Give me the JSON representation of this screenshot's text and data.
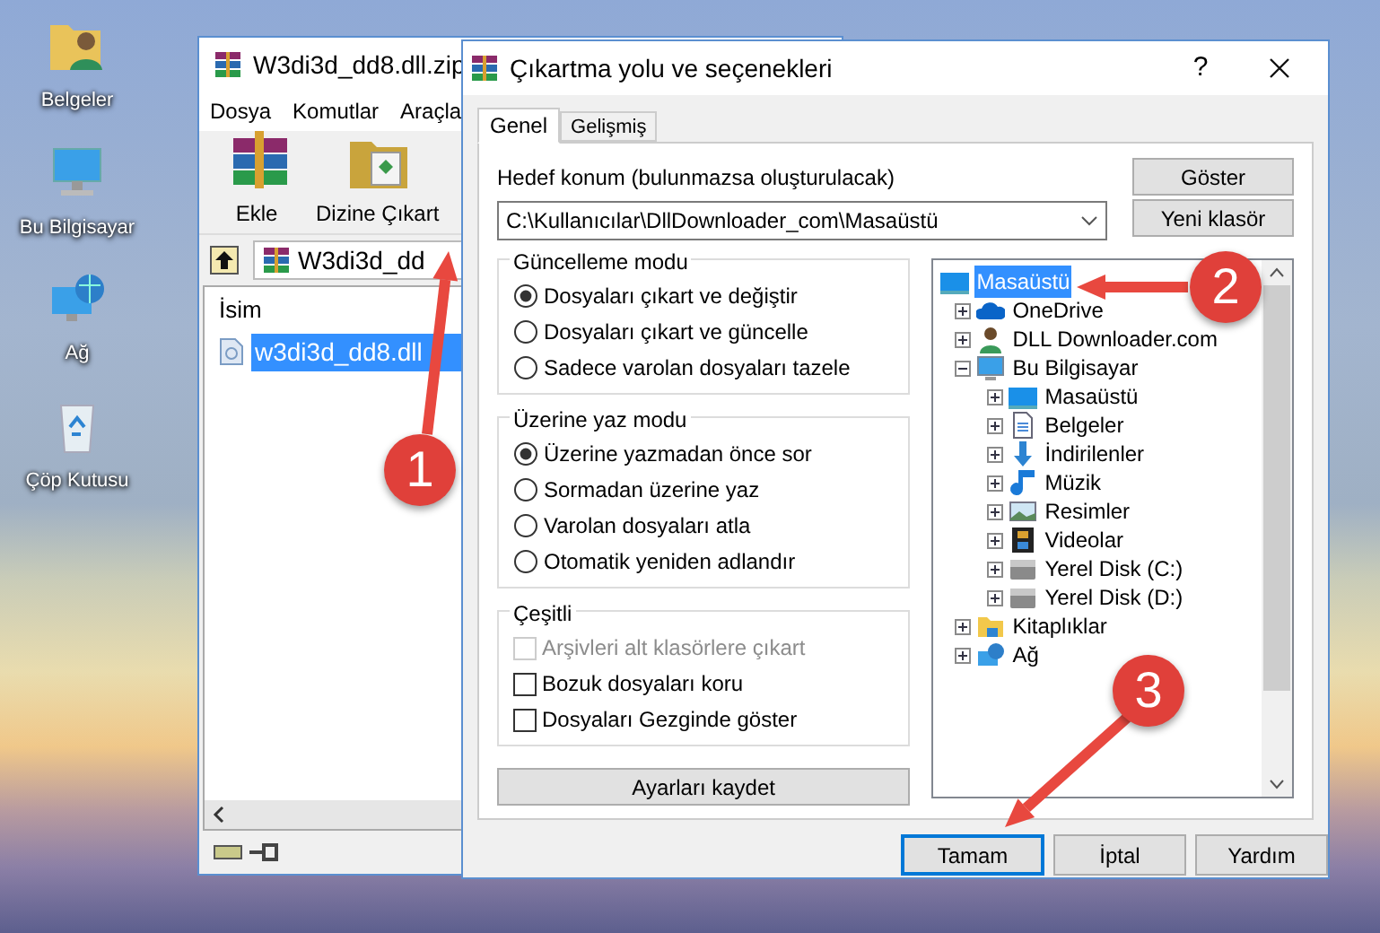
{
  "desktop_icons": [
    {
      "label": "Belgeler",
      "kind": "documents"
    },
    {
      "label": "Bu Bilgisayar",
      "kind": "computer"
    },
    {
      "label": "Ağ",
      "kind": "network"
    },
    {
      "label": "Çöp Kutusu",
      "kind": "recycle"
    }
  ],
  "archive_window": {
    "title": "W3di3d_dd8.dll.zip",
    "menu": [
      "Dosya",
      "Komutlar",
      "Araçla"
    ],
    "toolbar": [
      {
        "label": "Ekle",
        "kind": "add"
      },
      {
        "label": "Dizine Çıkart",
        "kind": "extract"
      }
    ],
    "address": "W3di3d_dd",
    "column": "İsim",
    "files": [
      {
        "name": "w3di3d_dd8.dll",
        "selected": true
      }
    ]
  },
  "dialog": {
    "title": "Çıkartma yolu ve seçenekleri",
    "help": "?",
    "tabs": [
      {
        "label": "Genel",
        "selected": true
      },
      {
        "label": "Gelişmiş",
        "selected": false
      }
    ],
    "destination_label": "Hedef konum (bulunmazsa oluşturulacak)",
    "destination_path": "C:\\Kullanıcılar\\DllDownloader_com\\Masaüstü",
    "side_buttons": [
      "Göster",
      "Yeni klasör"
    ],
    "groups": [
      {
        "title": "Güncelleme modu",
        "kind": "radio",
        "options": [
          {
            "label": "Dosyaları çıkart ve değiştir",
            "checked": true
          },
          {
            "label": "Dosyaları çıkart ve güncelle",
            "checked": false
          },
          {
            "label": "Sadece varolan dosyaları tazele",
            "checked": false
          }
        ]
      },
      {
        "title": "Üzerine yaz modu",
        "kind": "radio",
        "options": [
          {
            "label": "Üzerine yazmadan önce sor",
            "checked": true
          },
          {
            "label": "Sormadan üzerine yaz",
            "checked": false
          },
          {
            "label": "Varolan dosyaları atla",
            "checked": false
          },
          {
            "label": "Otomatik yeniden adlandır",
            "checked": false
          }
        ]
      },
      {
        "title": "Çeşitli",
        "kind": "checkbox",
        "options": [
          {
            "label": "Arşivleri alt klasörlere çıkart",
            "checked": false,
            "disabled": true
          },
          {
            "label": "Bozuk dosyaları koru",
            "checked": false,
            "disabled": false
          },
          {
            "label": "Dosyaları Gezginde göster",
            "checked": false,
            "disabled": false
          }
        ]
      }
    ],
    "save_button": "Ayarları kaydet",
    "tree": [
      {
        "label": "Masaüstü",
        "kind": "desktop",
        "selected": true,
        "children": [
          {
            "label": "OneDrive",
            "kind": "cloud",
            "selected": false,
            "expanded": false
          },
          {
            "label": "DLL Downloader.com",
            "kind": "user",
            "selected": false,
            "expanded": false
          },
          {
            "label": "Bu Bilgisayar",
            "kind": "computer",
            "selected": false,
            "expanded": true,
            "children": [
              {
                "label": "Masaüstü",
                "kind": "desktop",
                "selected": false,
                "expanded": false
              },
              {
                "label": "Belgeler",
                "kind": "document",
                "selected": false,
                "expanded": false
              },
              {
                "label": "İndirilenler",
                "kind": "download",
                "selected": false,
                "expanded": false
              },
              {
                "label": "Müzik",
                "kind": "music",
                "selected": false,
                "expanded": false
              },
              {
                "label": "Resimler",
                "kind": "image",
                "selected": false,
                "expanded": false
              },
              {
                "label": "Videolar",
                "kind": "video",
                "selected": false,
                "expanded": false
              },
              {
                "label": "Yerel Disk (C:)",
                "kind": "drive",
                "selected": false,
                "expanded": false
              },
              {
                "label": "Yerel Disk (D:)",
                "kind": "drive",
                "selected": false,
                "expanded": false
              }
            ]
          },
          {
            "label": "Kitaplıklar",
            "kind": "folder",
            "selected": false,
            "expanded": false
          },
          {
            "label": "Ağ",
            "kind": "network",
            "selected": false,
            "expanded": false
          }
        ]
      }
    ],
    "footer_buttons": [
      {
        "label": "Tamam",
        "default": true
      },
      {
        "label": "İptal",
        "default": false
      },
      {
        "label": "Yardım",
        "default": false
      }
    ]
  },
  "annotations": [
    {
      "number": "1"
    },
    {
      "number": "2"
    },
    {
      "number": "3"
    }
  ]
}
